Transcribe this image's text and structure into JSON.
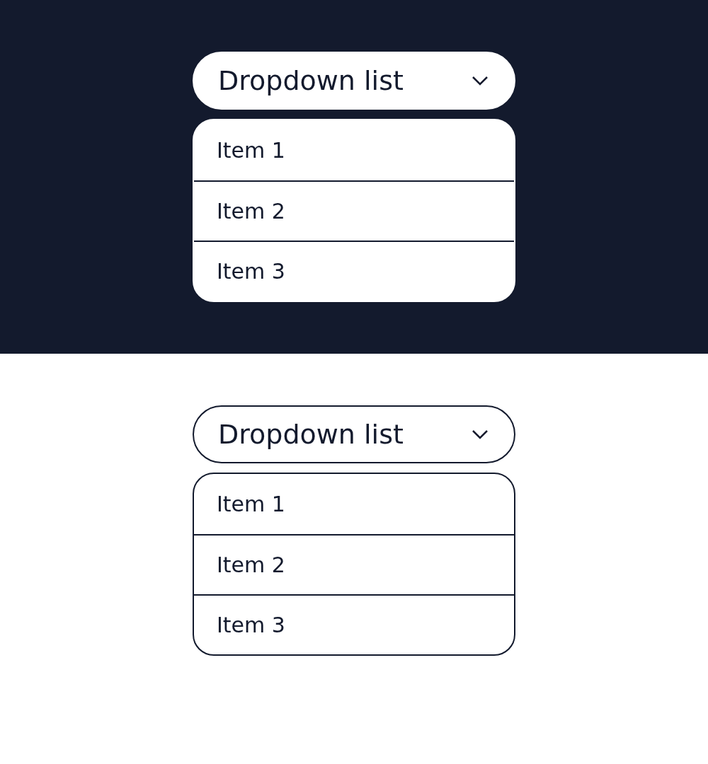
{
  "panels": [
    {
      "kind": "filled",
      "dropdown": {
        "label": "Dropdown list",
        "expanded": true
      },
      "items": [
        "Item 1",
        "Item 2",
        "Item 3"
      ]
    },
    {
      "kind": "outlined",
      "dropdown": {
        "label": "Dropdown list",
        "expanded": true
      },
      "items": [
        "Item 1",
        "Item 2",
        "Item 3"
      ]
    }
  ]
}
